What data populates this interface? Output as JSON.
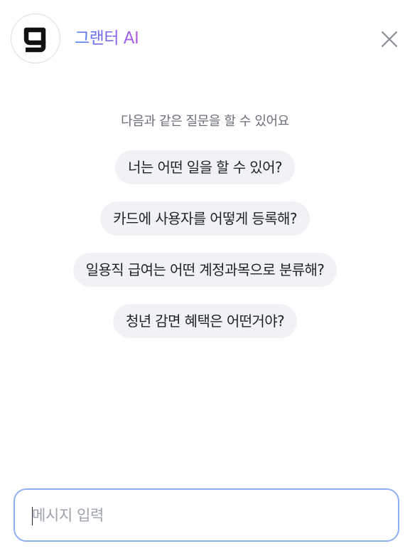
{
  "header": {
    "logo_icon": "grenter-g-logo",
    "title": "그랜터 AI",
    "close_icon": "close-icon"
  },
  "suggestions": {
    "heading": "다음과 같은 질문을 할 수 있어요",
    "items": [
      {
        "label": "너는 어떤 일을 할 수 있어?"
      },
      {
        "label": "카드에 사용자를 어떻게 등록해?"
      },
      {
        "label": "일용직 급여는 어떤 계정과목으로 분류해?"
      },
      {
        "label": "청년 감면 혜택은 어떤거야?"
      }
    ]
  },
  "composer": {
    "placeholder": "메시지 입력",
    "value": ""
  },
  "colors": {
    "accent_start": "#4a7cf0",
    "accent_end": "#b35cdc",
    "input_border": "#8eaff5",
    "chip_bg": "#f1f2f5"
  }
}
